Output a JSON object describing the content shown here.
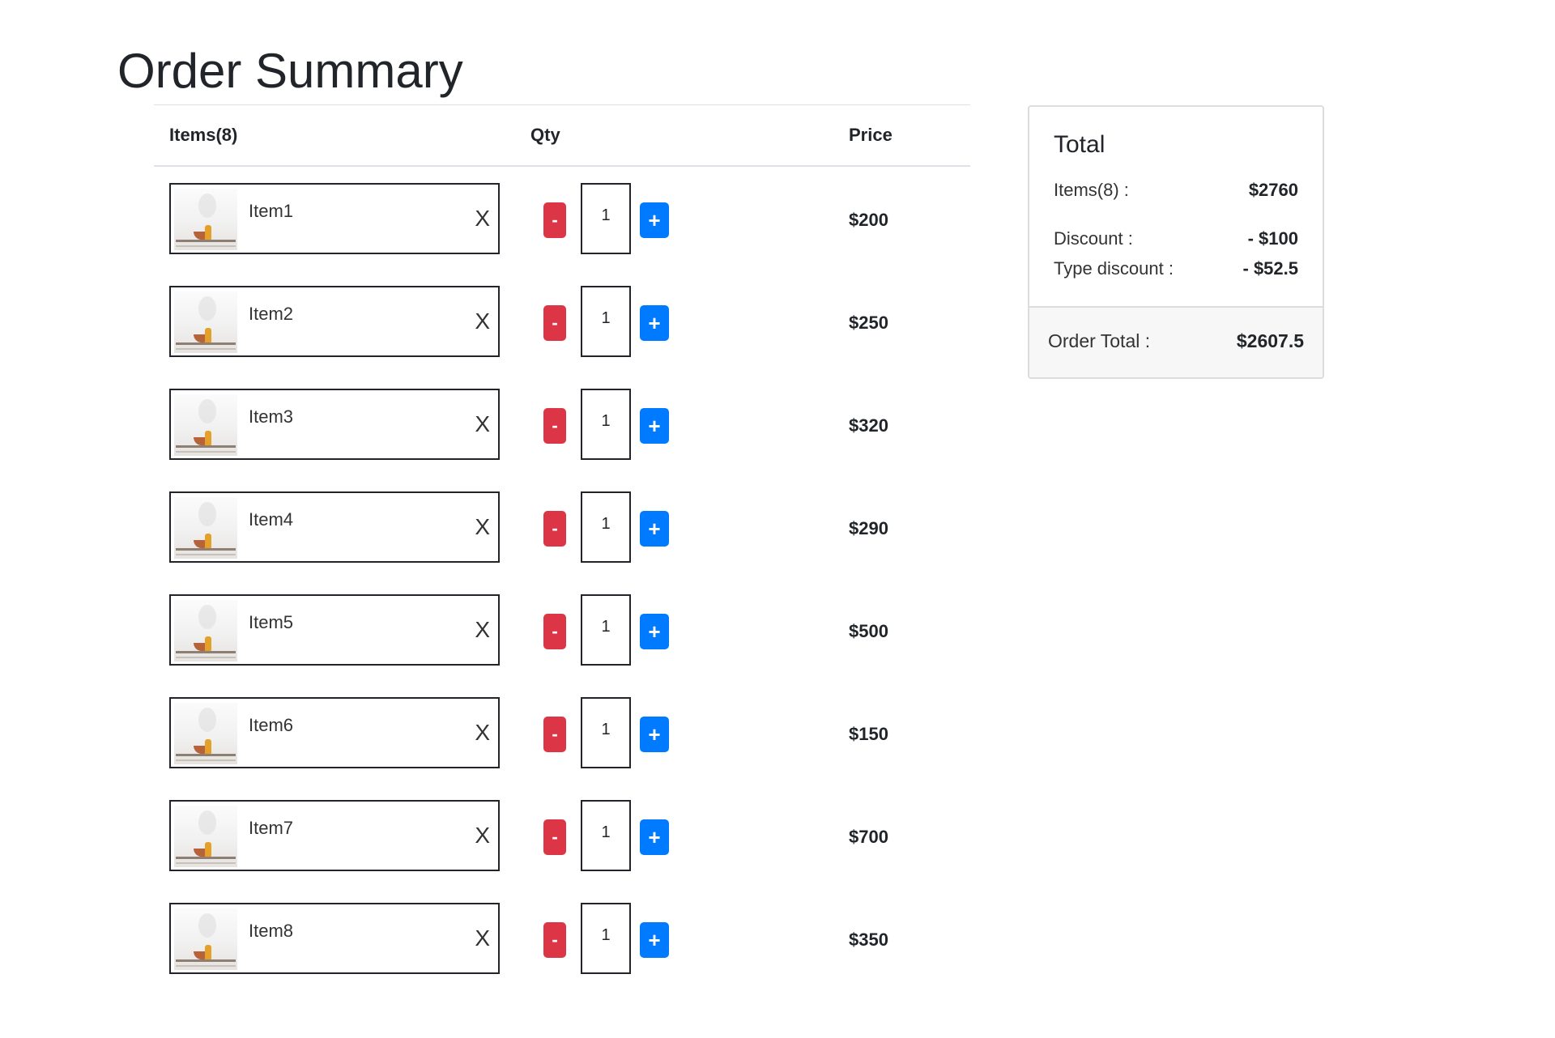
{
  "page": {
    "title": "Order Summary"
  },
  "cart": {
    "headers": {
      "items": "Items(8)",
      "qty": "Qty",
      "price": "Price"
    },
    "remove_label": "X",
    "minus_label": "-",
    "plus_label": "+",
    "items": [
      {
        "name": "Item1",
        "qty": "1",
        "price": "$200"
      },
      {
        "name": "Item2",
        "qty": "1",
        "price": "$250"
      },
      {
        "name": "Item3",
        "qty": "1",
        "price": "$320"
      },
      {
        "name": "Item4",
        "qty": "1",
        "price": "$290"
      },
      {
        "name": "Item5",
        "qty": "1",
        "price": "$500"
      },
      {
        "name": "Item6",
        "qty": "1",
        "price": "$150"
      },
      {
        "name": "Item7",
        "qty": "1",
        "price": "$700"
      },
      {
        "name": "Item8",
        "qty": "1",
        "price": "$350"
      }
    ]
  },
  "summary": {
    "title": "Total",
    "items_label": "Items(8) :",
    "items_value": "$2760",
    "discount_label": "Discount :",
    "discount_value": "- $100",
    "type_discount_label": "Type discount :",
    "type_discount_value": "- $52.5",
    "order_total_label": "Order Total :",
    "order_total_value": "$2607.5"
  },
  "colors": {
    "minus_button": "#dc3545",
    "plus_button": "#007bff",
    "text": "#212529"
  }
}
